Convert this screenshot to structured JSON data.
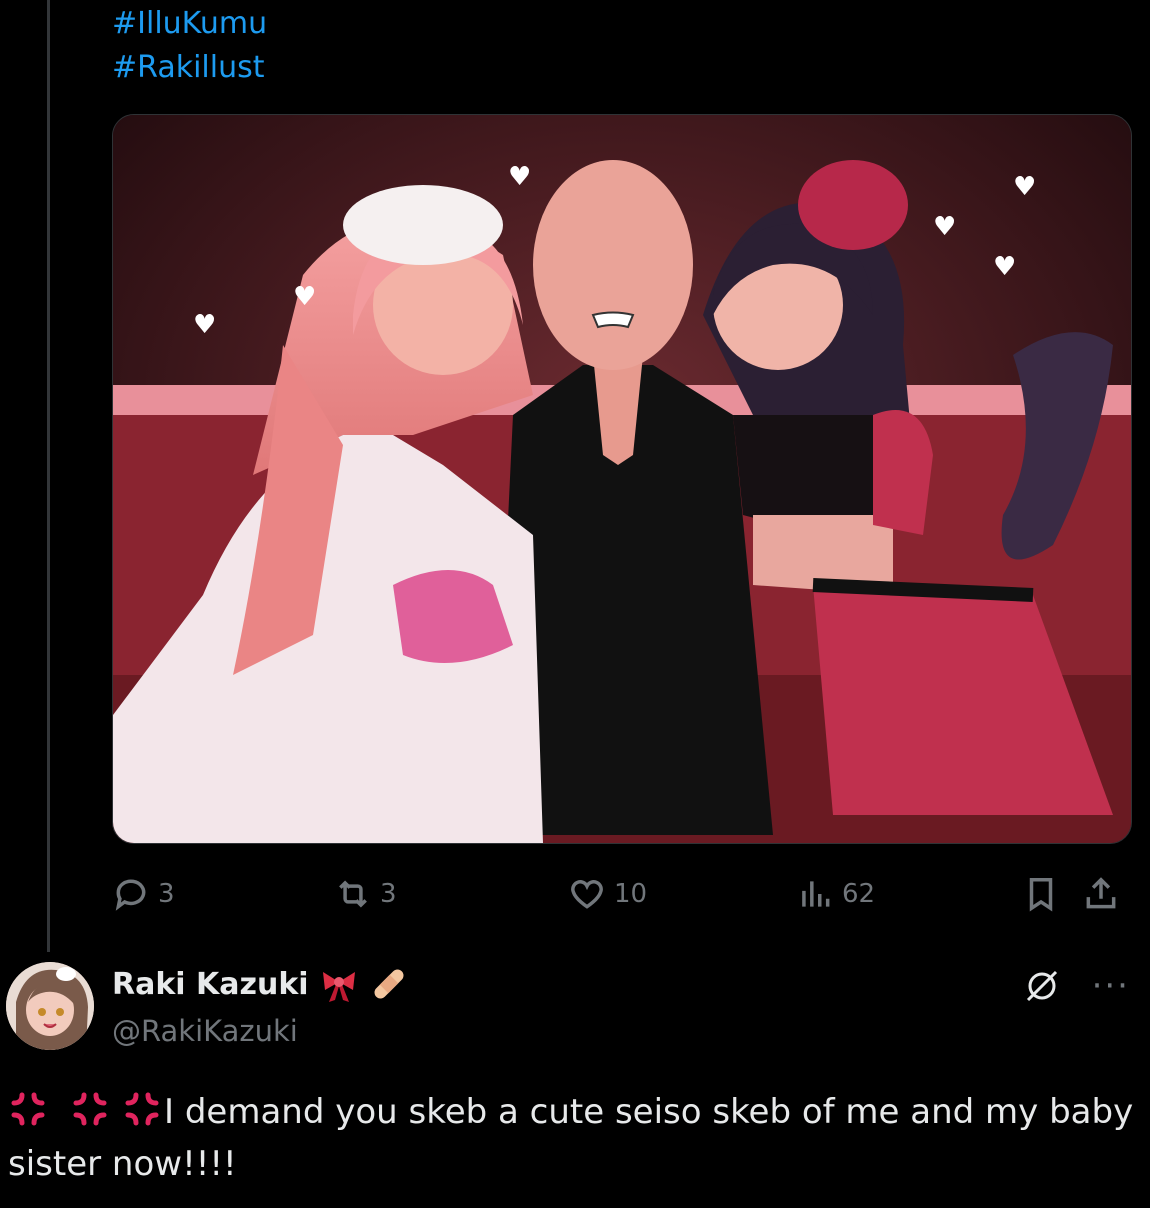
{
  "tweet": {
    "hashtags": [
      "#IlluKumu",
      "#Rakillust"
    ],
    "image_alt": "Illustration of two anime girls kissing the cheeks of a faceless man",
    "stats": {
      "replies": "3",
      "reposts": "3",
      "likes": "10",
      "views": "62"
    }
  },
  "reply": {
    "author_name": "Raki Kazuki",
    "handle": "@RakiKazuki",
    "text": "I demand you skeb a cute seiso skeb of me and my baby sister now!!!!",
    "name_emojis": [
      "ribbon-emoji",
      "bandage-emoji"
    ]
  },
  "colors": {
    "link": "#1d9bf0",
    "muted": "#71767b",
    "text": "#e7e9ea",
    "background": "#000000"
  }
}
